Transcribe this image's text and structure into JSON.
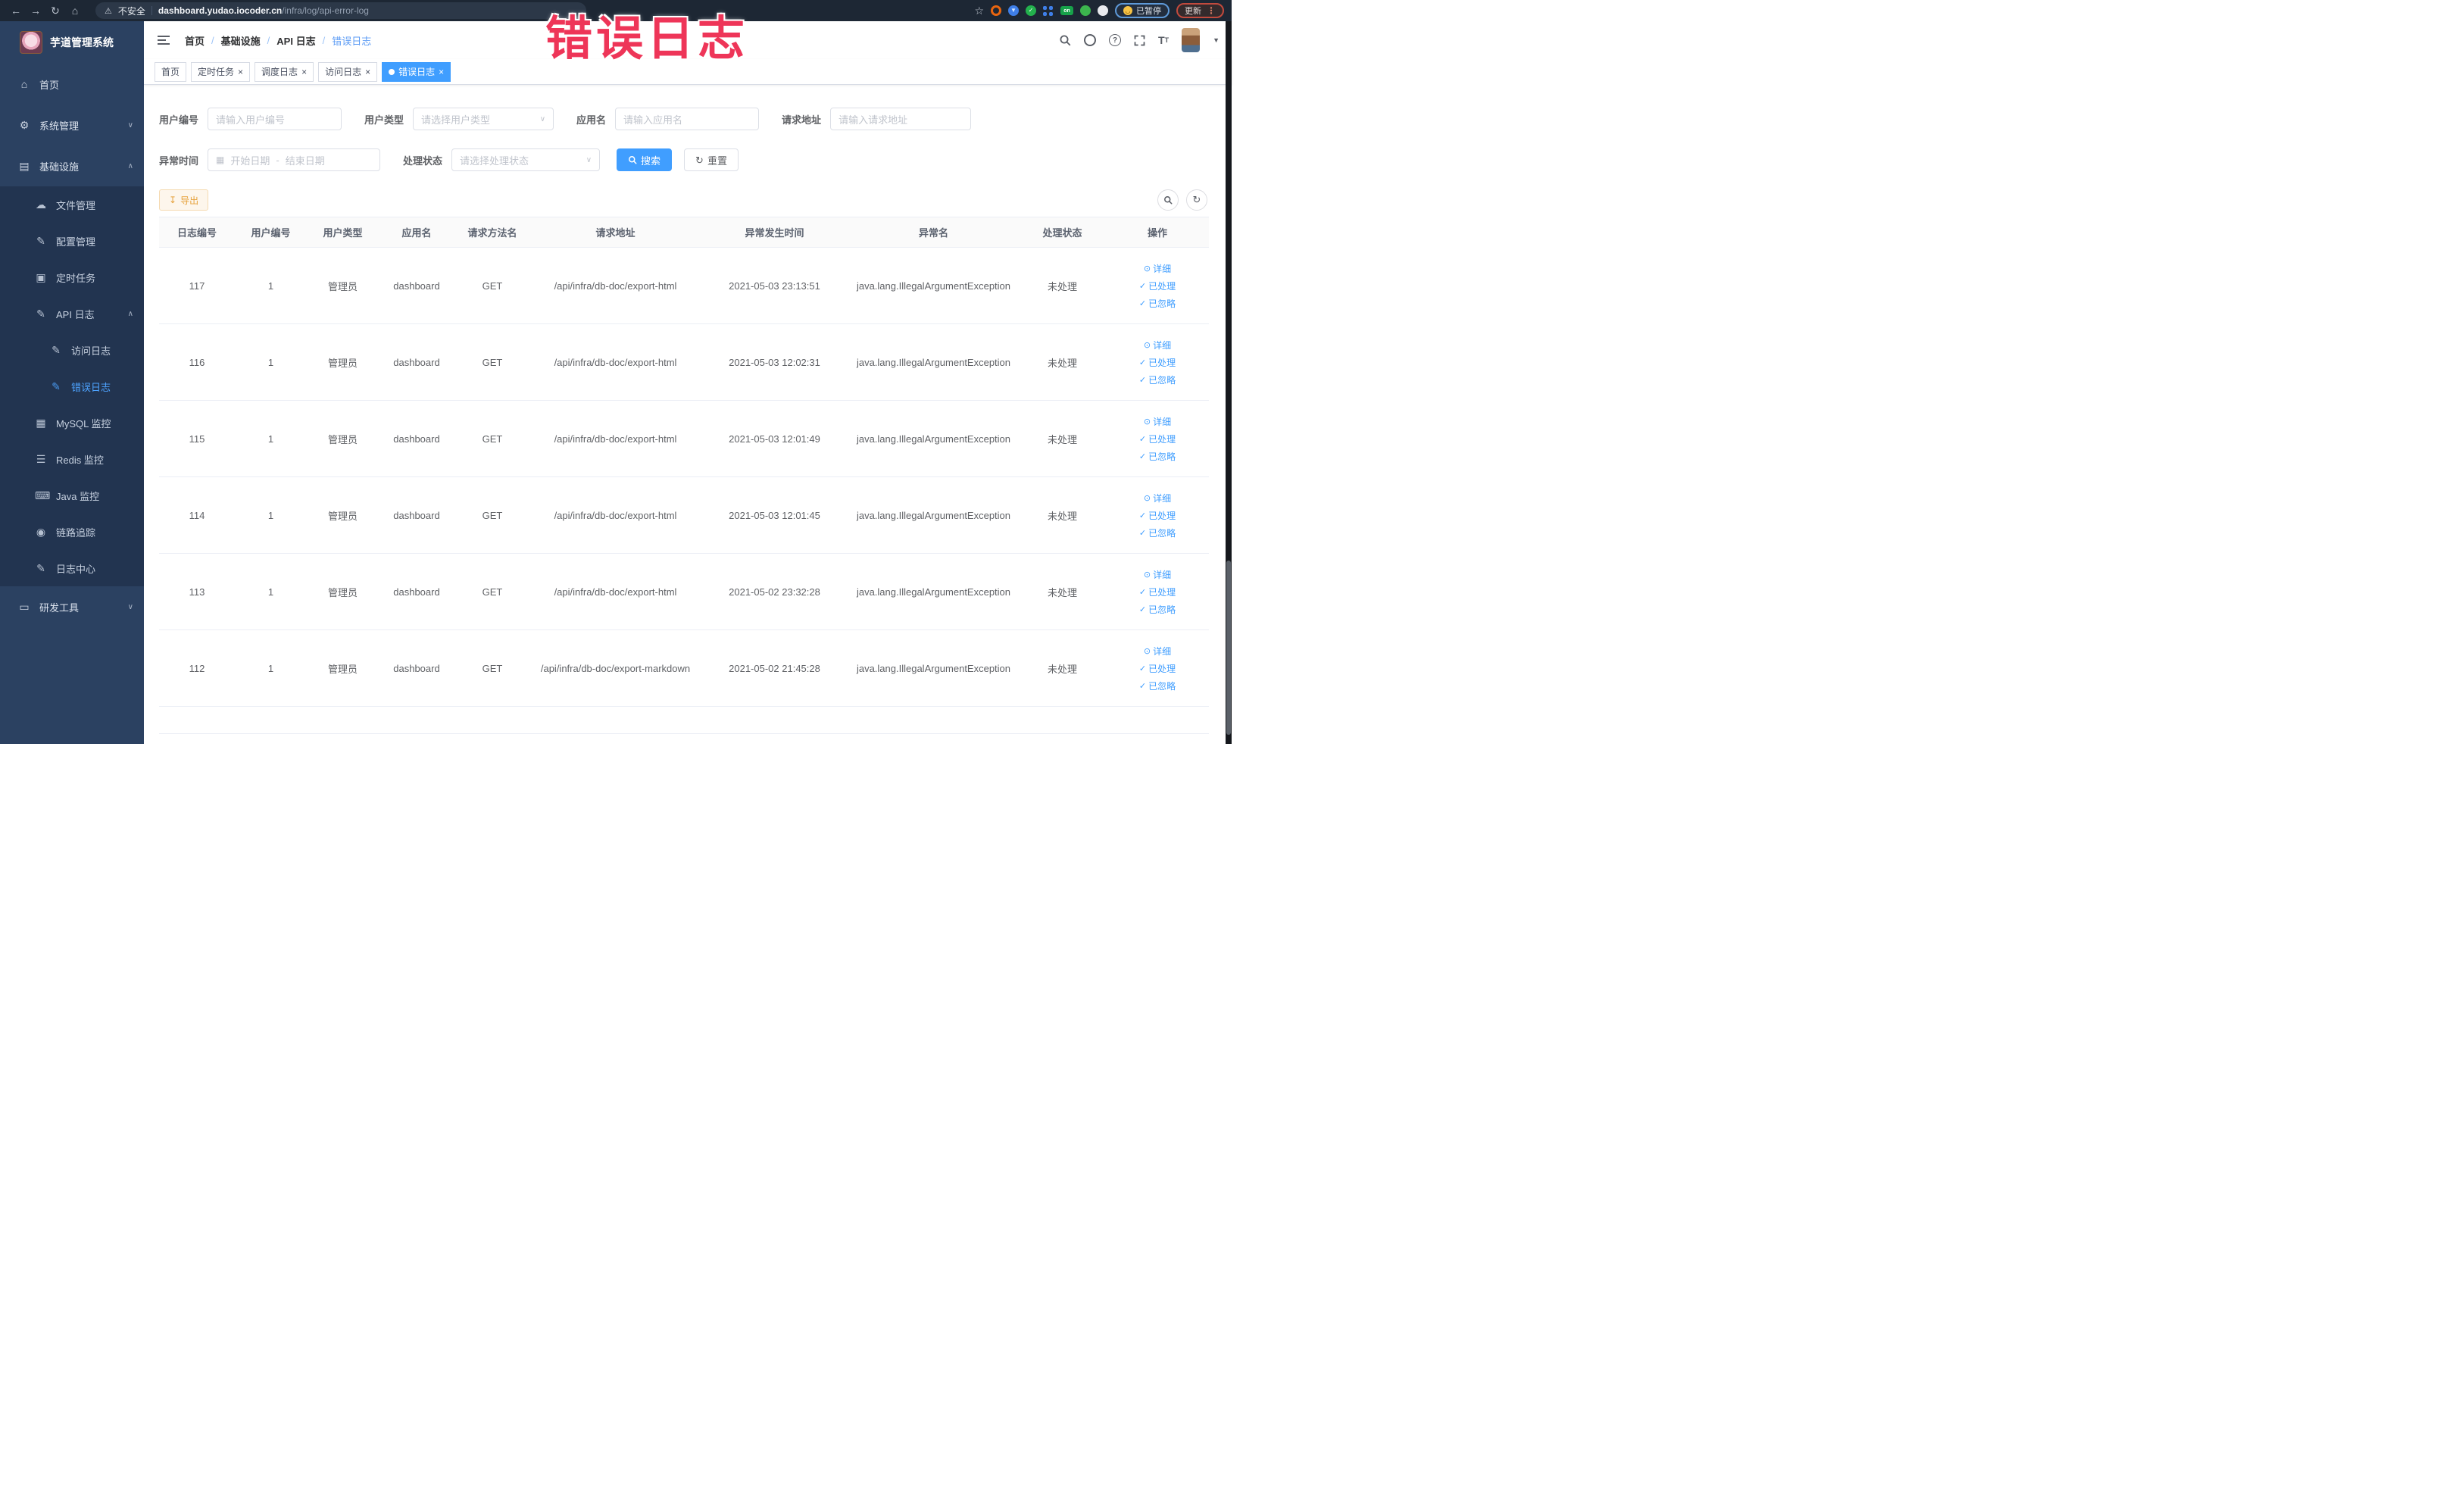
{
  "browser": {
    "insecure_label": "不安全",
    "url_host": "dashboard.yudao.iocoder.cn",
    "url_path": "/infra/log/api-error-log",
    "paused_badge": "已暂停",
    "update_button": "更新",
    "extensions": [
      {
        "name": "extension-orange-ring",
        "style": "ring",
        "color": "#e8650f"
      },
      {
        "name": "extension-blue-shield",
        "style": "solid",
        "color": "#3f7fe8",
        "glyph": "▼",
        "glyph_color": "#cfe4ff"
      },
      {
        "name": "extension-green-check",
        "style": "solid",
        "color": "#23b14d",
        "glyph": "✓",
        "glyph_color": "#ffffff"
      },
      {
        "name": "extension-blue-grid",
        "style": "grid",
        "color": "#3f7fe8"
      },
      {
        "name": "extension-green-on-badge",
        "style": "badge",
        "color": "#17a24a",
        "glyph": "on",
        "glyph_color": "#ffffff"
      },
      {
        "name": "extension-green-leaf",
        "style": "solid",
        "color": "#3cb54e",
        "glyph": "",
        "glyph_color": "#ffffff"
      },
      {
        "name": "extension-puzzle",
        "style": "solid",
        "color": "#e8eaee",
        "glyph": "",
        "glyph_color": "#888888"
      }
    ]
  },
  "annotation": {
    "text": "错误日志",
    "color": "#ee3558"
  },
  "sidebar": {
    "title": "芋道管理系统",
    "items": [
      {
        "label": "首页",
        "depth": 0,
        "icon": "home-icon"
      },
      {
        "label": "系统管理",
        "depth": 0,
        "icon": "gear-icon",
        "chevron": "down"
      },
      {
        "label": "基础设施",
        "depth": 0,
        "icon": "monitor-icon",
        "chevron": "up"
      },
      {
        "label": "文件管理",
        "depth": 1,
        "icon": "cloud-icon"
      },
      {
        "label": "配置管理",
        "depth": 1,
        "icon": "edit-icon"
      },
      {
        "label": "定时任务",
        "depth": 1,
        "icon": "schedule-icon"
      },
      {
        "label": "API 日志",
        "depth": 1,
        "icon": "log-icon",
        "chevron": "up"
      },
      {
        "label": "访问日志",
        "depth": 2,
        "icon": "log-icon"
      },
      {
        "label": "错误日志",
        "depth": 2,
        "icon": "log-icon",
        "active": true
      },
      {
        "label": "MySQL 监控",
        "depth": 1,
        "icon": "chart-icon"
      },
      {
        "label": "Redis 监控",
        "depth": 1,
        "icon": "layers-icon"
      },
      {
        "label": "Java 监控",
        "depth": 1,
        "icon": "java-icon"
      },
      {
        "label": "链路追踪",
        "depth": 1,
        "icon": "trace-icon"
      },
      {
        "label": "日志中心",
        "depth": 1,
        "icon": "log-center-icon"
      },
      {
        "label": "研发工具",
        "depth": 0,
        "icon": "tools-icon",
        "chevron": "down"
      }
    ]
  },
  "navbar": {
    "breadcrumbs": [
      {
        "label": "首页"
      },
      {
        "label": "基础设施"
      },
      {
        "label": "API 日志"
      },
      {
        "label": "错误日志",
        "active": true
      }
    ]
  },
  "tabs": [
    {
      "label": "首页"
    },
    {
      "label": "定时任务",
      "closable": true
    },
    {
      "label": "调度日志",
      "closable": true
    },
    {
      "label": "访问日志",
      "closable": true
    },
    {
      "label": "错误日志",
      "closable": true,
      "active": true
    }
  ],
  "filters": {
    "user_id": {
      "label": "用户编号",
      "placeholder": "请输入用户编号"
    },
    "user_type": {
      "label": "用户类型",
      "placeholder": "请选择用户类型"
    },
    "app_name": {
      "label": "应用名",
      "placeholder": "请输入应用名"
    },
    "request_url": {
      "label": "请求地址",
      "placeholder": "请输入请求地址"
    },
    "exception_time": {
      "label": "异常时间",
      "start_placeholder": "开始日期",
      "separator": "-",
      "end_placeholder": "结束日期"
    },
    "process_status": {
      "label": "处理状态",
      "placeholder": "请选择处理状态"
    },
    "search_button": "搜索",
    "reset_button": "重置"
  },
  "toolbar": {
    "export_button": "导出"
  },
  "table": {
    "columns": [
      "日志编号",
      "用户编号",
      "用户类型",
      "应用名",
      "请求方法名",
      "请求地址",
      "异常发生时间",
      "异常名",
      "处理状态",
      "操作"
    ],
    "row_actions": {
      "detail": "详细",
      "processed": "已处理",
      "ignored": "已忽略"
    },
    "rows": [
      {
        "id": "117",
        "user_id": "1",
        "user_type": "管理员",
        "app_name": "dashboard",
        "method": "GET",
        "url": "/api/infra/db-doc/export-html",
        "time": "2021-05-03 23:13:51",
        "exception": "java.lang.IllegalArgumentException",
        "status": "未处理"
      },
      {
        "id": "116",
        "user_id": "1",
        "user_type": "管理员",
        "app_name": "dashboard",
        "method": "GET",
        "url": "/api/infra/db-doc/export-html",
        "time": "2021-05-03 12:02:31",
        "exception": "java.lang.IllegalArgumentException",
        "status": "未处理"
      },
      {
        "id": "115",
        "user_id": "1",
        "user_type": "管理员",
        "app_name": "dashboard",
        "method": "GET",
        "url": "/api/infra/db-doc/export-html",
        "time": "2021-05-03 12:01:49",
        "exception": "java.lang.IllegalArgumentException",
        "status": "未处理"
      },
      {
        "id": "114",
        "user_id": "1",
        "user_type": "管理员",
        "app_name": "dashboard",
        "method": "GET",
        "url": "/api/infra/db-doc/export-html",
        "time": "2021-05-03 12:01:45",
        "exception": "java.lang.IllegalArgumentException",
        "status": "未处理"
      },
      {
        "id": "113",
        "user_id": "1",
        "user_type": "管理员",
        "app_name": "dashboard",
        "method": "GET",
        "url": "/api/infra/db-doc/export-html",
        "time": "2021-05-02 23:32:28",
        "exception": "java.lang.IllegalArgumentException",
        "status": "未处理"
      },
      {
        "id": "112",
        "user_id": "1",
        "user_type": "管理员",
        "app_name": "dashboard",
        "method": "GET",
        "url": "/api/infra/db-doc/export-markdown",
        "time": "2021-05-02 21:45:28",
        "exception": "java.lang.IllegalArgumentException",
        "status": "未处理"
      }
    ]
  }
}
